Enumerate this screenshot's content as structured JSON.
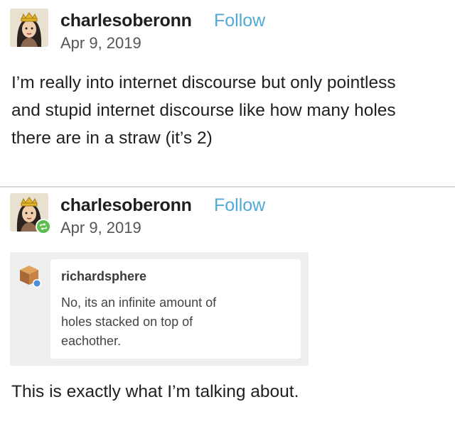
{
  "post1": {
    "username": "charlesoberonn",
    "follow_label": "Follow",
    "date": "Apr 9, 2019",
    "body_lines": [
      "I’m really into internet discourse but only pointless",
      "and stupid internet discourse like how many holes",
      "there are in a straw (it’s 2)"
    ]
  },
  "post2": {
    "username": "charlesoberonn",
    "follow_label": "Follow",
    "date": "Apr 9, 2019",
    "quoted": {
      "username": "richardsphere",
      "text_lines": [
        "No, its an infinite amount of",
        "holes stacked on top of",
        "eachother."
      ]
    },
    "closing_text": "This is exactly what I’m talking about."
  },
  "colors": {
    "follow": "#52a9d8",
    "reblog_badge": "#5cbf4d",
    "quote_background": "#eeeeee"
  },
  "icons": {
    "avatar": "queen-avatar-icon",
    "reblog": "reblog-icon",
    "quoted_avatar": "cube-avatar-icon"
  }
}
